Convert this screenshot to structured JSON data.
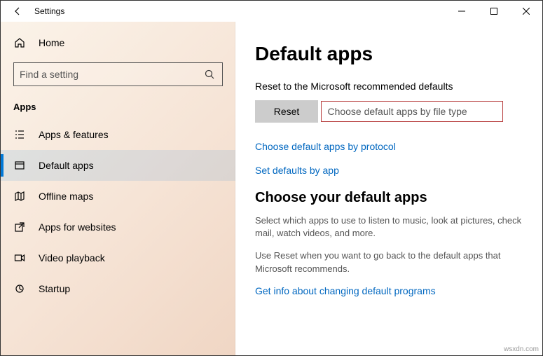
{
  "titlebar": {
    "title": "Settings"
  },
  "sidebar": {
    "home_label": "Home",
    "search_placeholder": "Find a setting",
    "section_title": "Apps",
    "items": [
      {
        "label": "Apps & features"
      },
      {
        "label": "Default apps"
      },
      {
        "label": "Offline maps"
      },
      {
        "label": "Apps for websites"
      },
      {
        "label": "Video playback"
      },
      {
        "label": "Startup"
      }
    ]
  },
  "main": {
    "heading": "Default apps",
    "reset_label_text": "Reset to the Microsoft recommended defaults",
    "reset_button": "Reset",
    "link_filetype": "Choose default apps by file type",
    "link_protocol": "Choose default apps by protocol",
    "link_setbyapp": "Set defaults by app",
    "subheading": "Choose your default apps",
    "body1": "Select which apps to use to listen to music, look at pictures, check mail, watch videos, and more.",
    "body2": "Use Reset when you want to go back to the default apps that Microsoft recommends.",
    "link_info": "Get info about changing default programs"
  },
  "watermark": "wsxdn.com"
}
